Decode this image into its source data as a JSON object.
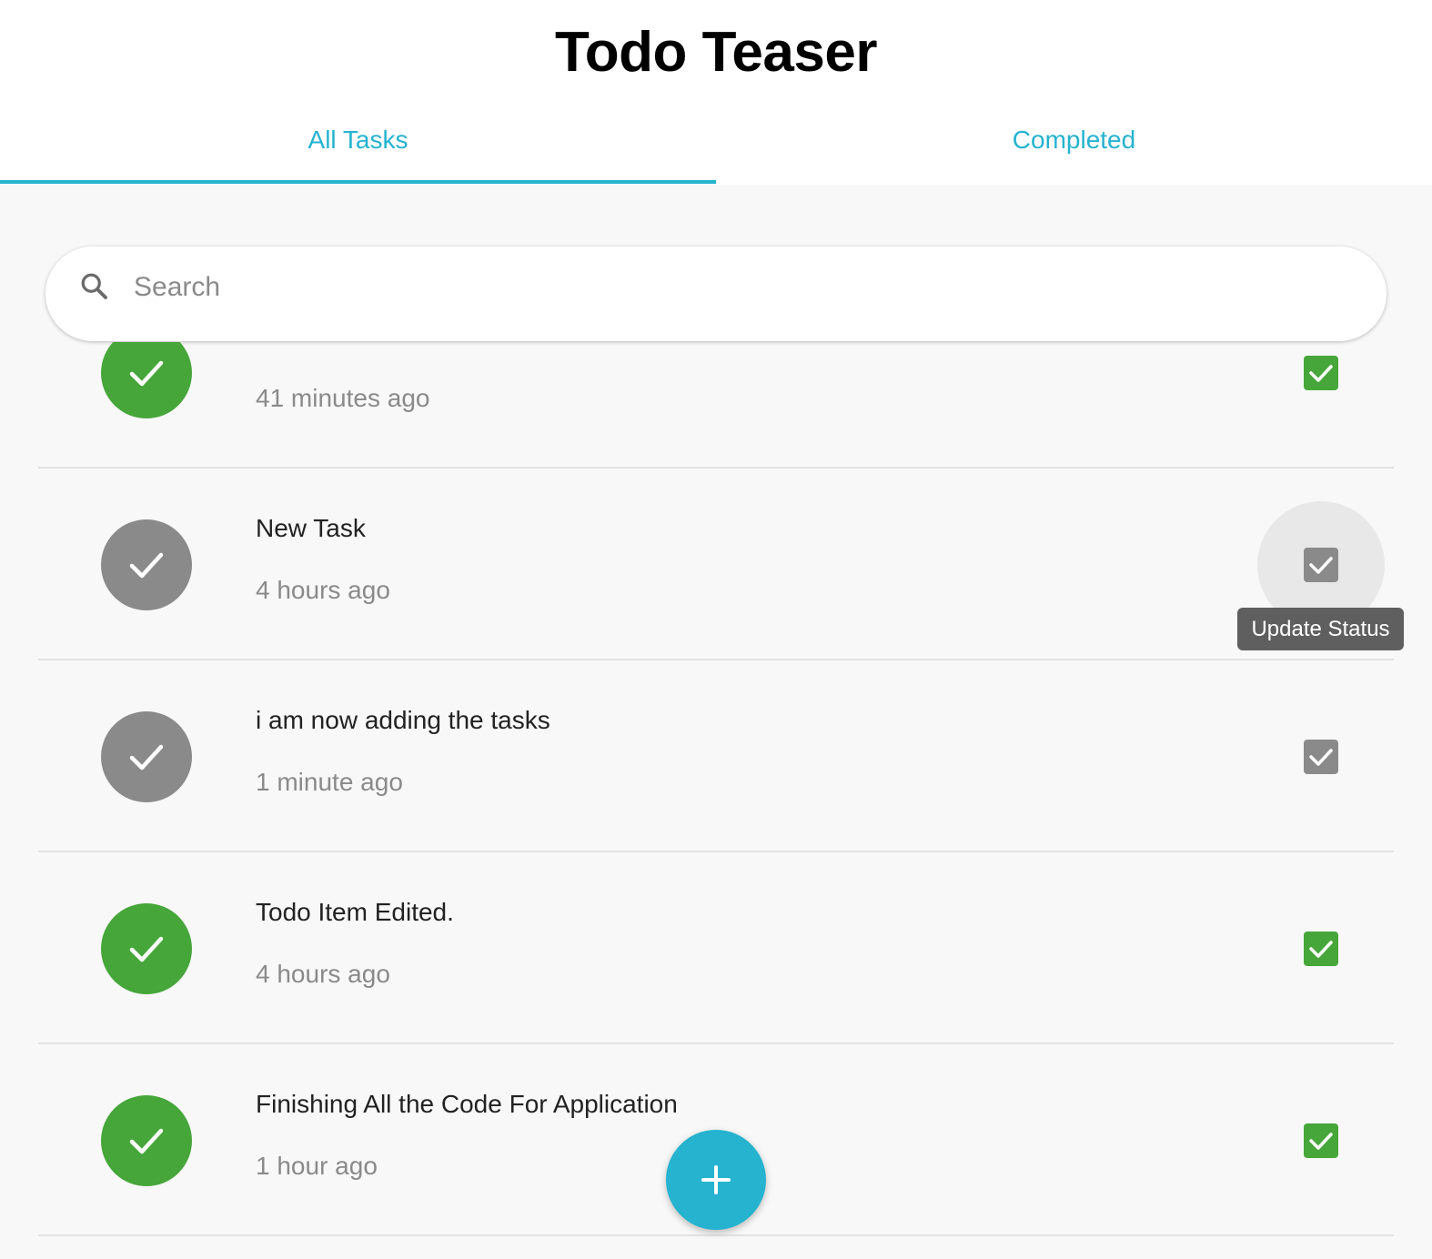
{
  "app": {
    "title": "Todo Teaser"
  },
  "tabs": [
    {
      "label": "All Tasks",
      "active": true
    },
    {
      "label": "Completed",
      "active": false
    }
  ],
  "search": {
    "placeholder": "Search",
    "value": ""
  },
  "tasks": [
    {
      "title": "",
      "time": "41 minutes ago",
      "completed": true
    },
    {
      "title": "New Task",
      "time": "4 hours ago",
      "completed": false
    },
    {
      "title": "i am now adding the tasks",
      "time": "1 minute ago",
      "completed": false
    },
    {
      "title": "Todo Item Edited.",
      "time": "4 hours ago",
      "completed": true
    },
    {
      "title": "Finishing All the Code For Application",
      "time": "1 hour ago",
      "completed": true
    }
  ],
  "tooltip": {
    "text": "Update Status"
  },
  "fab": {
    "icon": "plus-icon"
  },
  "colors": {
    "accent": "#25b3cf",
    "completed": "#46a63a",
    "pending": "#8a8a8a"
  }
}
